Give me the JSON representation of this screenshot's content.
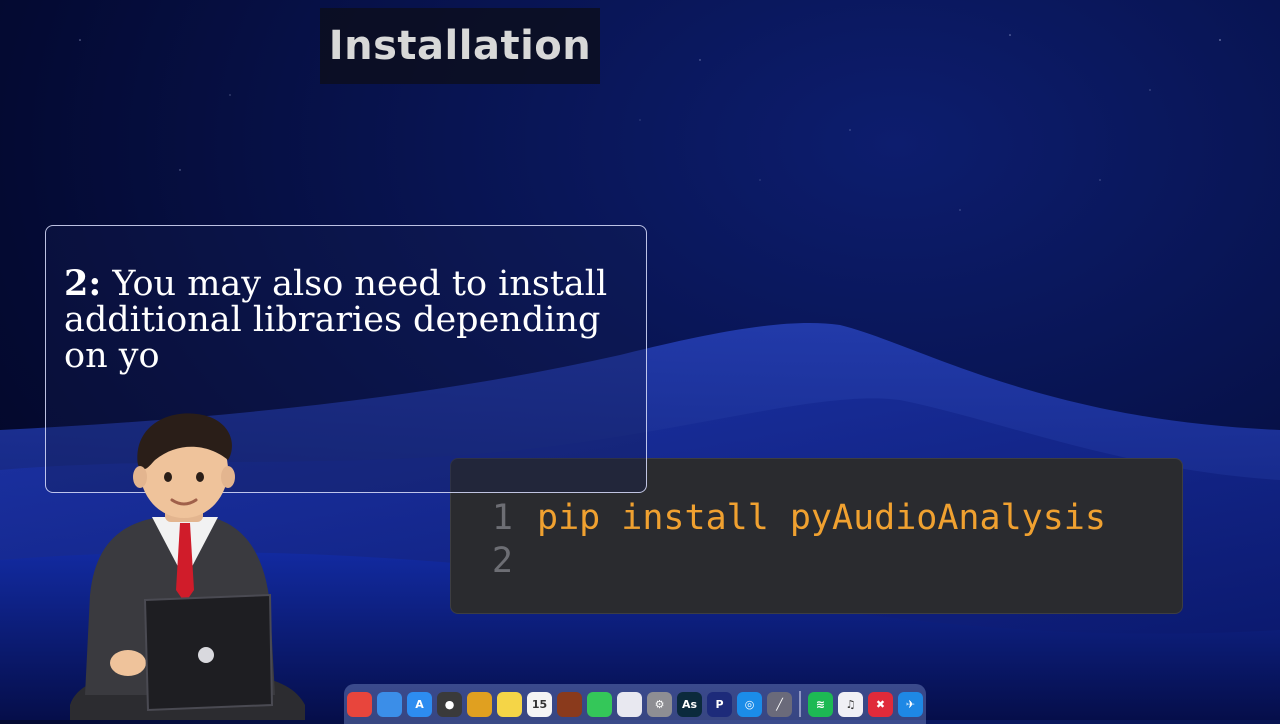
{
  "section_title": "Installation",
  "info_card": {
    "step_number": "2:",
    "text": "You may also need to install additional libraries depending on yo"
  },
  "code_editor": {
    "lines": [
      {
        "number": "1",
        "code": "pip install pyAudioAnalysis"
      },
      {
        "number": "2",
        "code": ""
      }
    ],
    "colors": {
      "code": "#f0a130",
      "line_number": "#6d6e74",
      "background": "#2a2b2f"
    }
  },
  "dock": {
    "apps": [
      {
        "name": "chrome-icon",
        "glyph": "",
        "color": "#e8453c"
      },
      {
        "name": "finder-folder-icon",
        "glyph": "",
        "color": "#3b8ee8"
      },
      {
        "name": "app-store-icon",
        "glyph": "A",
        "color": "#2d8cf0"
      },
      {
        "name": "camera-icon",
        "glyph": "●",
        "color": "#3a3a3a"
      },
      {
        "name": "chrome-alt-icon",
        "glyph": "",
        "color": "#e0a020"
      },
      {
        "name": "notes-icon",
        "glyph": "",
        "color": "#f5d547"
      },
      {
        "name": "calendar-icon",
        "glyph": "15",
        "color": "#f4f4f4"
      },
      {
        "name": "game-icon",
        "glyph": "",
        "color": "#8a3a1c"
      },
      {
        "name": "messages-icon",
        "glyph": "",
        "color": "#34c759"
      },
      {
        "name": "lasso-tool-icon",
        "glyph": "",
        "color": "#e8e8f0"
      },
      {
        "name": "settings-icon",
        "glyph": "⚙",
        "color": "#8e8e93"
      },
      {
        "name": "animate-icon",
        "glyph": "As",
        "color": "#0b2a3c"
      },
      {
        "name": "pycharm-icon",
        "glyph": "P",
        "color": "#1d2b7a"
      },
      {
        "name": "safari-icon",
        "glyph": "◎",
        "color": "#1b8ce8"
      },
      {
        "name": "pen-icon",
        "glyph": "╱",
        "color": "#6a6a7a"
      },
      {
        "name": "spotify-icon",
        "glyph": "≋",
        "color": "#1db954"
      },
      {
        "name": "music-icon",
        "glyph": "♫",
        "color": "#f0f0f5"
      },
      {
        "name": "capcut-icon",
        "glyph": "✖",
        "color": "#e02a3a"
      },
      {
        "name": "safari-compass-icon",
        "glyph": "✈",
        "color": "#1e88e5"
      }
    ]
  }
}
